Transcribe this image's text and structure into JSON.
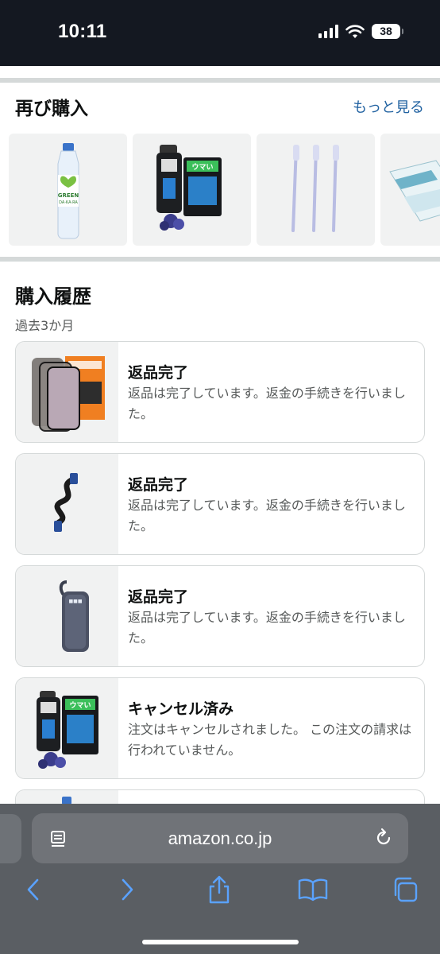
{
  "status_bar": {
    "time": "10:11",
    "battery": "38"
  },
  "buy_again": {
    "title": "再び購入",
    "see_more": "もっと見る",
    "items": [
      {
        "name": "GREEN DA·KA·RA 600ml bottle",
        "label": "GREEN\nDA·KA·RA"
      },
      {
        "name": "Vape device with Blue Berry pods",
        "label": "濃いウマい"
      },
      {
        "name": "Three toothbrushes",
        "label": ""
      },
      {
        "name": "Book",
        "label": ""
      }
    ]
  },
  "history": {
    "title": "購入履歴",
    "period": "過去3か月",
    "orders": [
      {
        "status": "返品完了",
        "description": "返品は完了しています。返金の手続きを行いました。",
        "thumb": "screen-protector"
      },
      {
        "status": "返品完了",
        "description": "返品は完了しています。返金の手続きを行いました。",
        "thumb": "usb-cable"
      },
      {
        "status": "返品完了",
        "description": "返品は完了しています。返金の手続きを行いました。",
        "thumb": "power-bank"
      },
      {
        "status": "キャンセル済み",
        "description": "注文はキャンセルされました。 この注文の請求は行われていません。",
        "thumb": "vape-device"
      }
    ]
  },
  "browser": {
    "url": "amazon.co.jp"
  },
  "colors": {
    "link": "#2162a1",
    "divider": "#d5d9d9",
    "status_bar": "#141821",
    "browser_chrome": "#5a5e63"
  }
}
